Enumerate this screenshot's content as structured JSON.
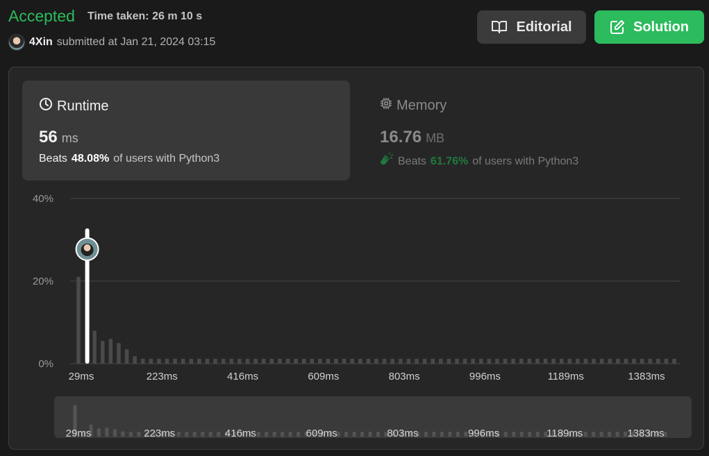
{
  "header": {
    "status": "Accepted",
    "time_taken": "Time taken: 26 m 10 s",
    "username": "4Xin",
    "submitted_text": "submitted at Jan 21, 2024 03:15",
    "editorial_label": "Editorial",
    "solution_label": "Solution"
  },
  "runtime": {
    "title": "Runtime",
    "value": "56",
    "unit": "ms",
    "beats_prefix": "Beats",
    "beats_pct": "48.08%",
    "beats_suffix": "of users with Python3"
  },
  "memory": {
    "title": "Memory",
    "value": "16.76",
    "unit": "MB",
    "beats_prefix": "Beats",
    "beats_pct": "61.76%",
    "beats_suffix": "of users with Python3"
  },
  "colors": {
    "accent_green": "#2cbb5d",
    "bar": "#4a4a4a",
    "marker": "#ffffff"
  },
  "chart_data": {
    "type": "bar",
    "ylim": [
      0,
      40
    ],
    "y_ticks": [
      "0%",
      "20%",
      "40%"
    ],
    "x_tick_labels": [
      "29ms",
      "223ms",
      "416ms",
      "609ms",
      "803ms",
      "996ms",
      "1189ms",
      "1383ms"
    ],
    "marker_value": "56ms",
    "values": [
      21,
      0,
      8,
      5.5,
      6,
      5,
      3.5,
      1.8,
      1.2,
      1.2,
      1.2,
      1.2,
      1.2,
      1.2,
      1.2,
      1.2,
      1.2,
      1.2,
      1.2,
      1.2,
      1.2,
      1.2,
      1.2,
      1.2,
      1.2,
      1.2,
      1.2,
      1.2,
      1.2,
      1.2,
      1.2,
      1.2,
      1.2,
      1.2,
      1.2,
      1.2,
      1.2,
      1.2,
      1.2,
      1.2,
      1.2,
      1.2,
      1.2,
      1.2,
      1.2,
      1.2,
      1.2,
      1.2,
      1.2,
      1.2,
      1.2,
      1.2,
      1.2,
      1.2,
      1.2,
      1.2,
      1.2,
      1.2,
      1.2,
      1.2,
      1.2,
      1.2,
      1.2,
      1.2,
      1.2,
      1.2,
      1.2,
      1.2,
      1.2,
      1.2,
      1.2,
      1.2,
      1.2,
      1.2,
      1.2
    ],
    "marker_index": 1,
    "grid": true
  }
}
